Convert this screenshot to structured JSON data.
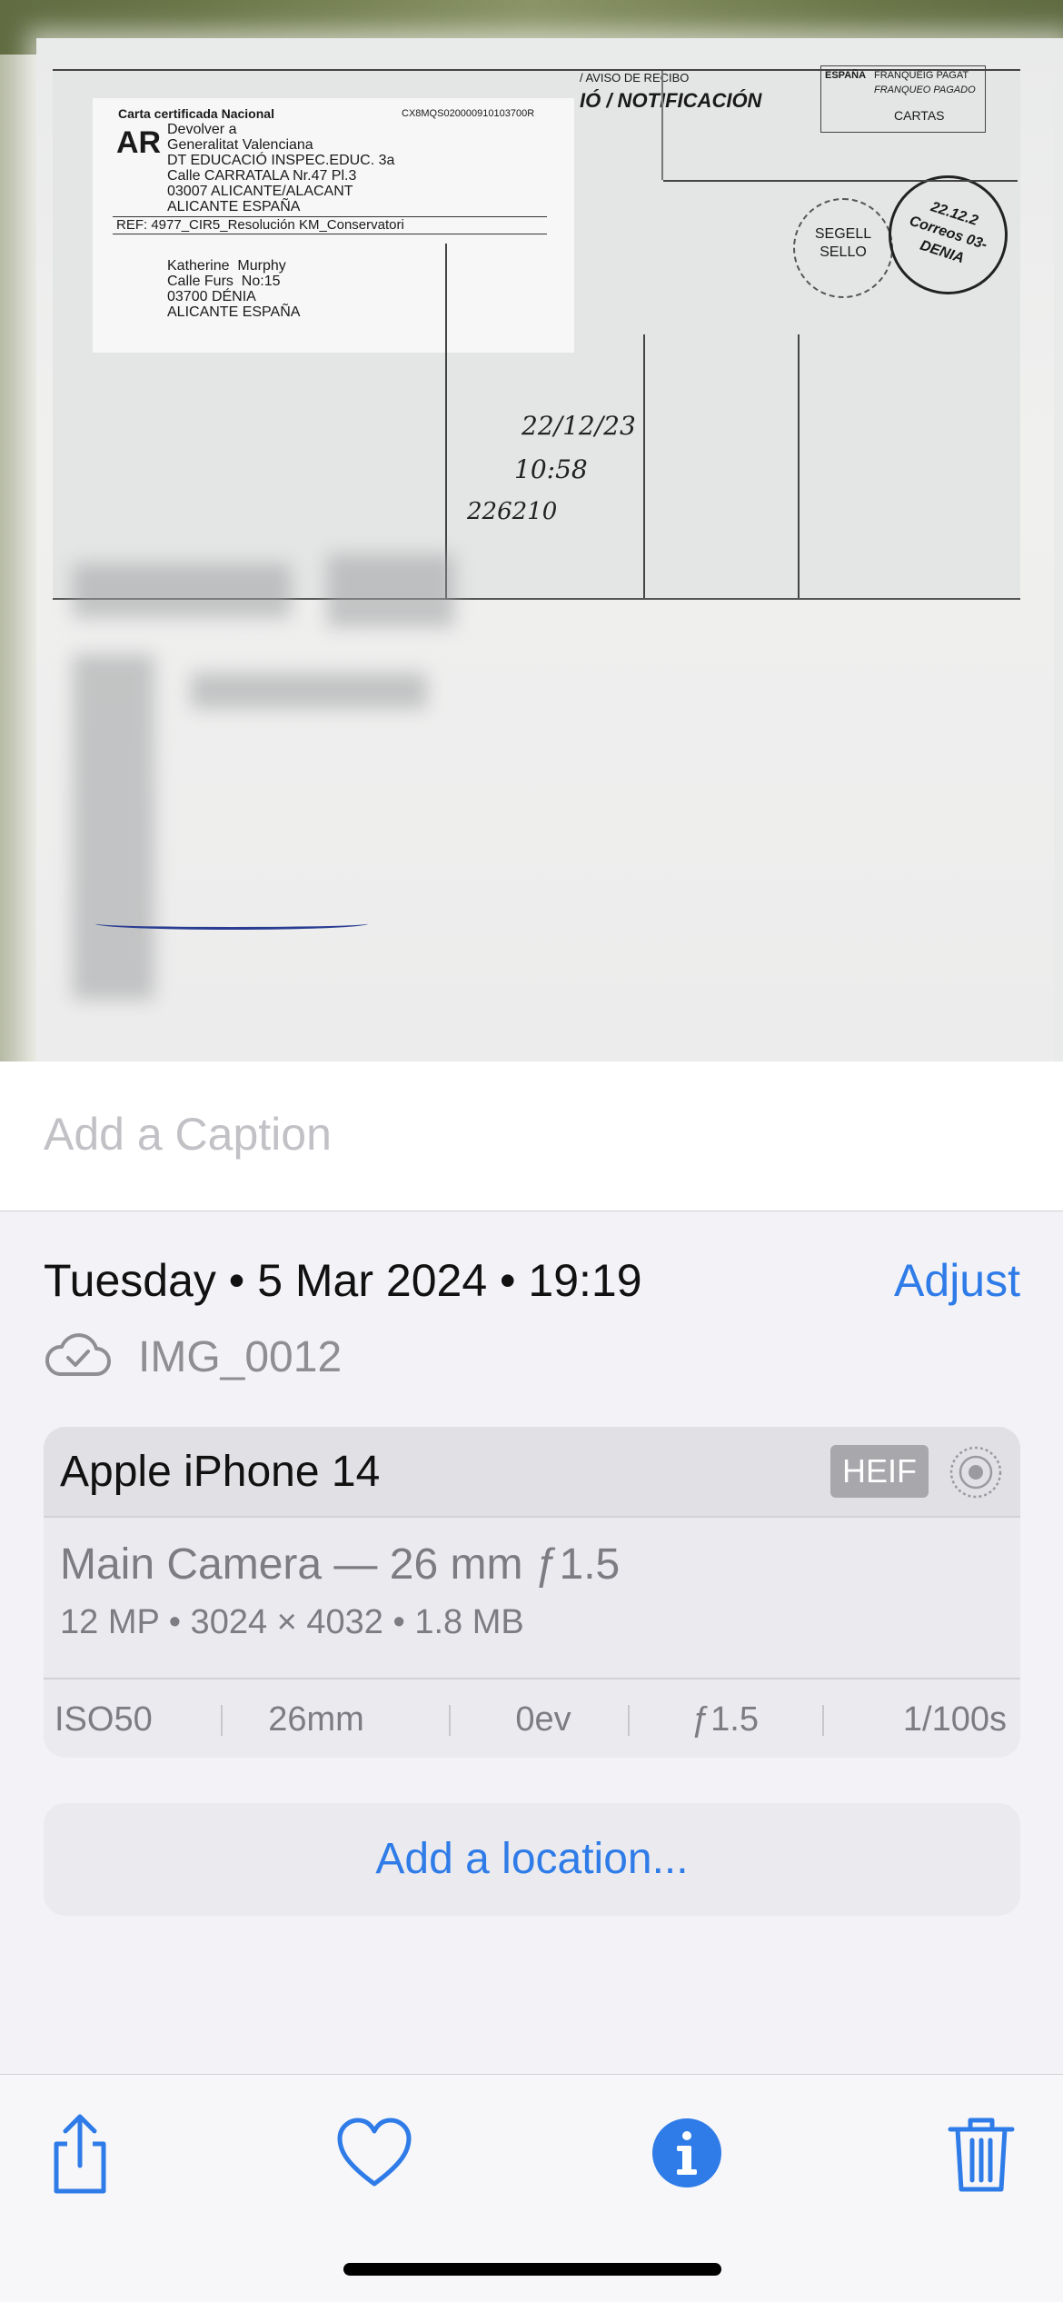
{
  "photo": {
    "label": {
      "header": "Carta certificada Nacional",
      "code": "CX8MQS020000910103700R",
      "ar": "AR",
      "return_lines": "Devolver a\nGeneralitat Valenciana\nDT EDUCACIÓ INSPEC.EDUC. 3a\nCalle CARRATALA Nr.47 Pl.3\n03007 ALICANTE/ALACANT\nALICANTE ESPAÑA",
      "ref": "REF:  4977_CIR5_Resolución KM_Conservatori",
      "address_lines": "Katherine  Murphy\nCalle Furs  No:15\n03700 DÉNIA\nALICANTE ESPAÑA"
    },
    "form_title_small": "/ AVISO DE RECIBO",
    "form_title": "IÓ / NOTIFICACIÓN",
    "stamp_lines": [
      "ESPAÑA",
      "FRANQUEIG PAGAT",
      "FRANQUEO PAGADO",
      "CARTAS"
    ],
    "seal_text": "SEGELL SELLO",
    "postmark_text": "22.12.2 Correos 03-DENIA",
    "handwritten_date": "22/12/23",
    "handwritten_time": "10:58",
    "handwritten_id": "226210"
  },
  "caption": {
    "placeholder": "Add a Caption"
  },
  "info": {
    "date": "Tuesday • 5 Mar 2024 • 19:19",
    "adjust_label": "Adjust",
    "filename": "IMG_0012",
    "cloud_icon": "cloud-check-icon"
  },
  "camera": {
    "device": "Apple iPhone 14",
    "format_badge": "HEIF",
    "lens": "Main Camera — 26 mm ƒ1.5",
    "specs": "12 MP  •  3024 × 4032  •  1.8 MB",
    "exif": [
      "ISO50",
      "26mm",
      "0ev",
      "ƒ1.5",
      "1/100s"
    ]
  },
  "location": {
    "label": "Add a location..."
  },
  "toolbar": {
    "share_icon": "share-icon",
    "favorite_icon": "heart-icon",
    "info_icon": "info-icon",
    "delete_icon": "trash-icon",
    "accent": "#2f7ce8"
  }
}
